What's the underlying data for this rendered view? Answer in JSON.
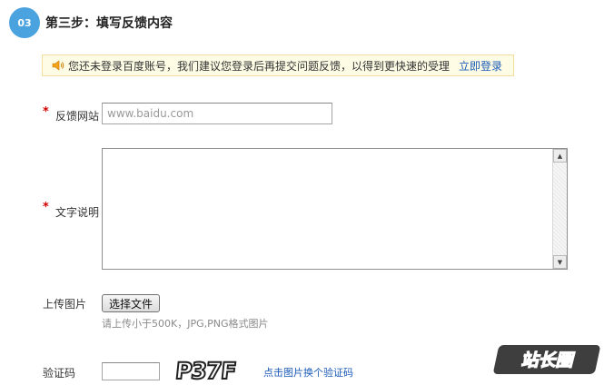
{
  "step": {
    "number": "03",
    "title": "第三步：填写反馈内容"
  },
  "notice": {
    "icon": "speaker-icon",
    "message": "您还未登录百度账号，我们建议您登录后再提交问题反馈，以得到更快速的受理",
    "login_link": "立即登录"
  },
  "form": {
    "required_mark": "*",
    "website": {
      "label": "反馈网站",
      "value": "www.baidu.com"
    },
    "description": {
      "label": "文字说明",
      "value": ""
    },
    "upload": {
      "label": "上传图片",
      "button": "选择文件",
      "hint": "请上传小于500K，JPG,PNG格式图片"
    },
    "captcha": {
      "label": "验证码",
      "value": "",
      "image_text": "P37F",
      "refresh_link": "点击图片换个验证码"
    }
  },
  "watermark": {
    "text": "站长圈"
  },
  "colors": {
    "accent": "#4aa3df",
    "link": "#1c5bb8",
    "required": "#d00000",
    "notice_bg": "#fffce5",
    "notice_border": "#f1de9c"
  }
}
